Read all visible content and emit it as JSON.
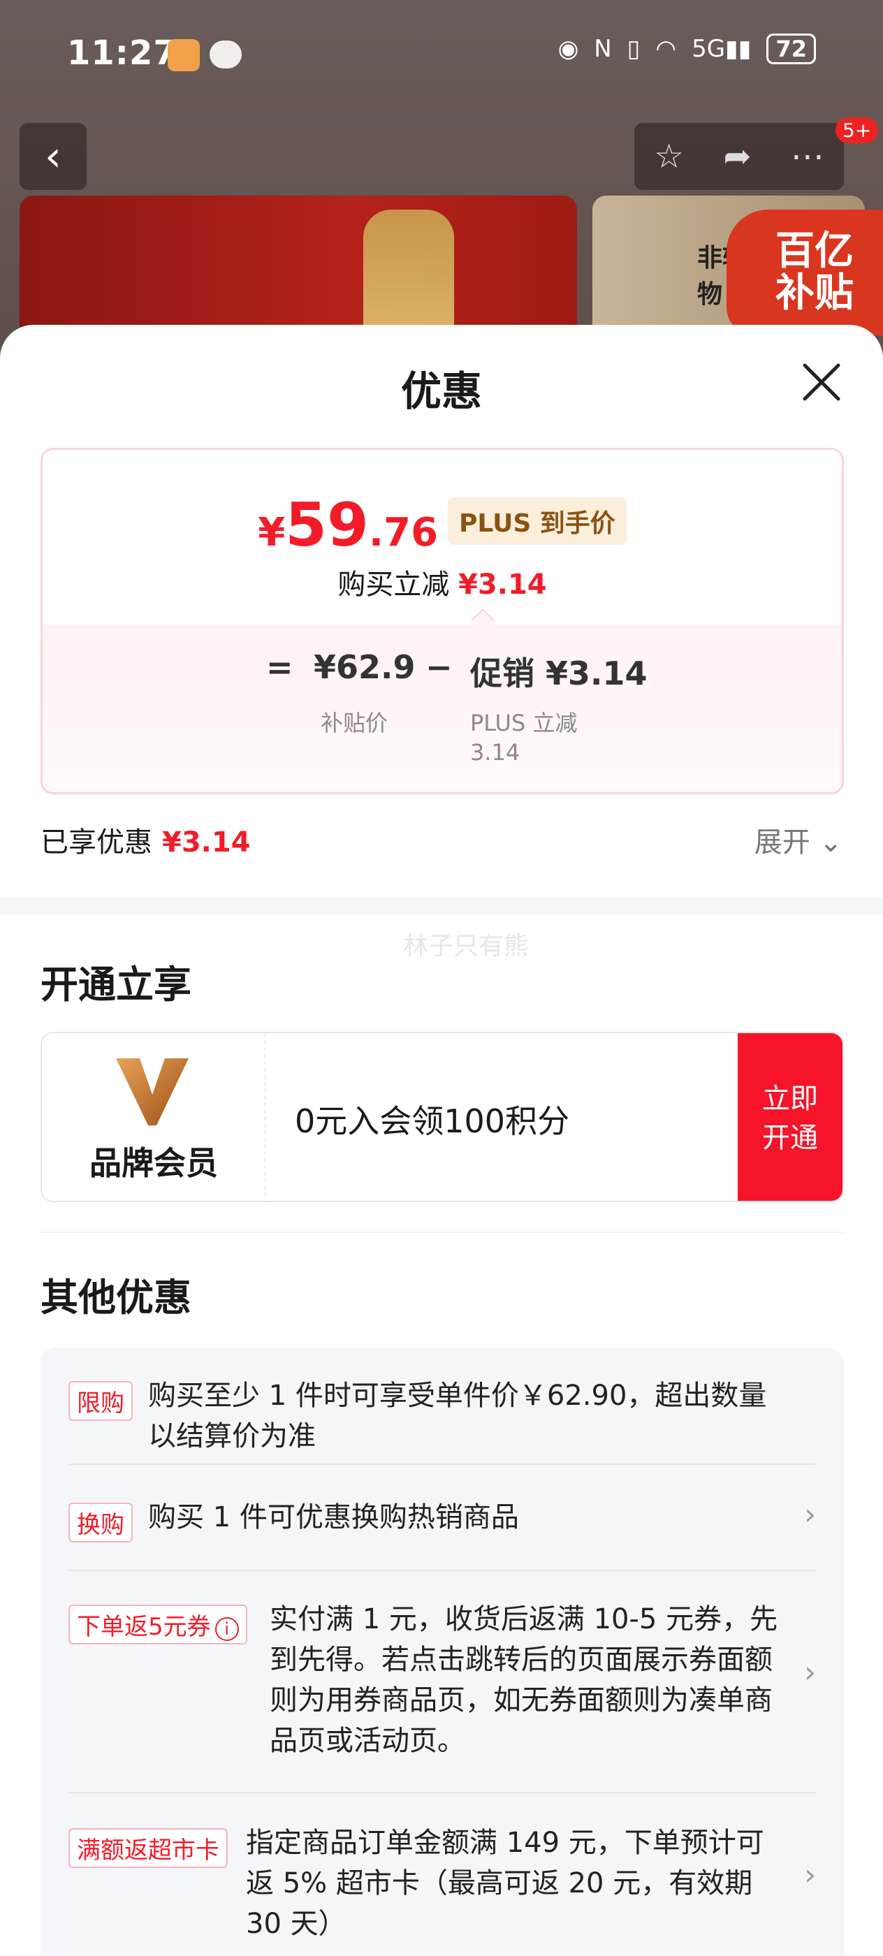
{
  "status_bar": {
    "time": "11:27",
    "network": "5G",
    "battery": "72"
  },
  "nav": {
    "notification_badge": "5+"
  },
  "banner": {
    "right_text": "非转\n物",
    "subsidy_text": "百亿\n补贴"
  },
  "sheet": {
    "title": "优惠",
    "price_card": {
      "currency": "¥",
      "price_int": "59",
      "price_dec": ".76",
      "plus_tag": "PLUS 到手价",
      "reduce_label": "购买立减",
      "reduce_value": "¥3.14",
      "formula": {
        "equals": "=",
        "subsidy_price": "¥62.9",
        "subsidy_label": "补贴价",
        "minus": "−",
        "promo": "促销 ¥3.14",
        "promo_label_1": "PLUS 立减",
        "promo_label_2": "3.14"
      }
    },
    "enjoyed_label": "已享优惠",
    "enjoyed_value": "¥3.14",
    "expand_label": "展开",
    "watermark": "林子只有熊",
    "open_section": {
      "title": "开通立享",
      "member_name": "品牌会员",
      "member_offer": "0元入会领100积分",
      "open_button": "立即\n开通"
    },
    "other_section": {
      "title": "其他优惠",
      "items": [
        {
          "tag": "限购",
          "desc": "购买至少 1 件时可享受单件价￥62.90，超出数量以结算价为准"
        },
        {
          "tag": "换购",
          "desc": "购买 1 件可优惠换购热销商品"
        },
        {
          "tag": "下单返5元券",
          "desc": "实付满 1 元，收货后返满 10-5 元券，先到先得。若点击跳转后的页面展示券面额则为用券商品页，如无券面额则为凑单商品页或活动页。"
        },
        {
          "tag": "满额返超市卡",
          "desc": "指定商品订单金额满 149 元，下单预计可返 5% 超市卡（最高可返 20 元，有效期 30 天）"
        }
      ]
    }
  }
}
